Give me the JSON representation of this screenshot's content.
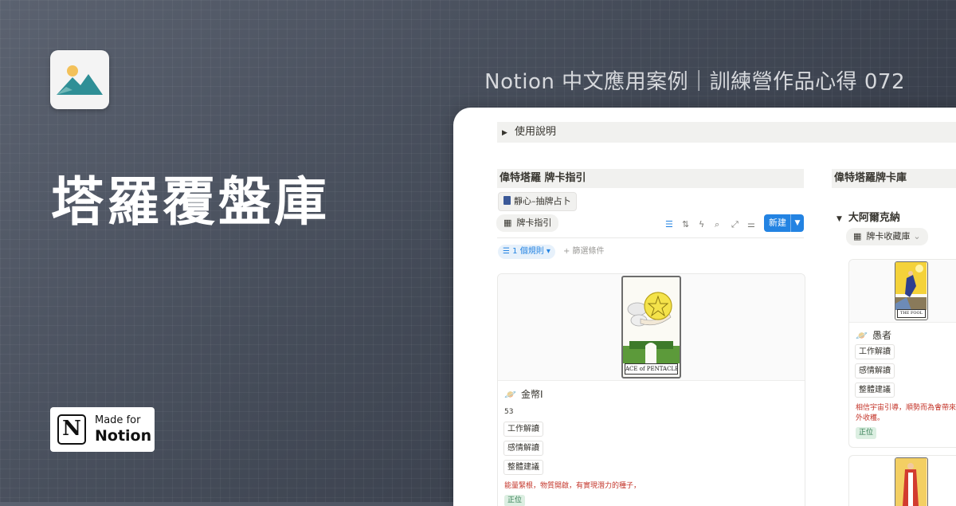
{
  "headline": "Notion 中文應用案例｜訓練營作品心得 072",
  "main_title": "塔羅覆盤庫",
  "badge": {
    "line1": "Made for",
    "line2": "Notion",
    "mark": "N"
  },
  "colors": {
    "accent": "#2383e2",
    "danger_text": "#c4362b",
    "positive_tag_bg": "#dcefe2"
  },
  "panel": {
    "toggle_label": "使用說明",
    "left": {
      "heading": "偉特塔羅 牌卡指引",
      "linked_page": "靜心–抽牌占卜",
      "view_tab": "牌卡指引",
      "new_button": "新建",
      "filter_rule": "1 個規則",
      "add_filter": "+ 篩選條件",
      "card": {
        "card_caption": "ACE of PENTACLES",
        "title": "金幣I",
        "number": "53",
        "tags": [
          "工作解讀",
          "感情解讀",
          "整體建議"
        ],
        "description": "能量緊根，物質開啟，有實現潛力的種子，",
        "position": "正位"
      }
    },
    "right": {
      "heading": "偉特塔羅牌卡庫",
      "group": "大阿爾克納",
      "view_tab": "牌卡收藏庫",
      "card": {
        "card_caption": "THE FOOL",
        "title": "愚者",
        "tags": [
          "工作解讀",
          "感情解讀",
          "整體建議"
        ],
        "description_line1": "相信宇宙引導，順勢而為會帶來",
        "description_line2": "外收穫。",
        "position": "正位"
      }
    }
  }
}
